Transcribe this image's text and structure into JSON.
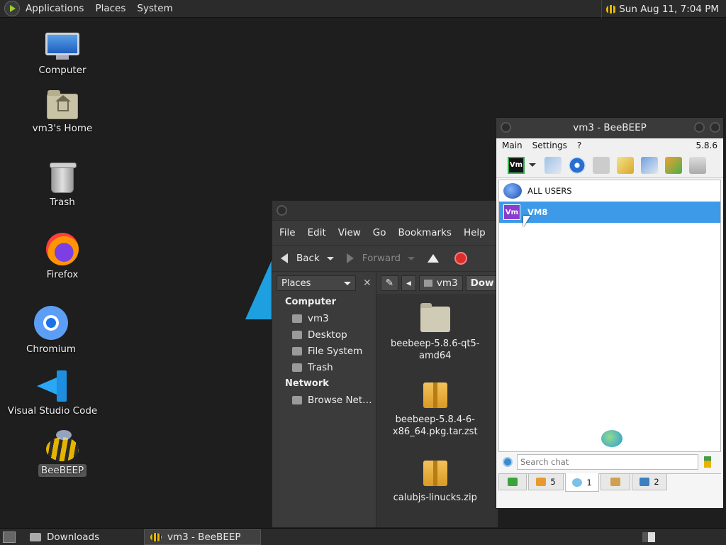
{
  "top_panel": {
    "menus": [
      "Applications",
      "Places",
      "System"
    ],
    "clock": "Sun Aug 11, 7:04 PM"
  },
  "desktop": {
    "icons": [
      {
        "label": "Computer",
        "icon": "computer-icon"
      },
      {
        "label": "vm3's Home",
        "icon": "home-folder-icon"
      },
      {
        "label": "Trash",
        "icon": "trash-icon"
      },
      {
        "label": "Firefox",
        "icon": "firefox-icon"
      },
      {
        "label": "Chromium",
        "icon": "chromium-icon"
      },
      {
        "label": "Visual Studio Code",
        "icon": "vscode-icon"
      },
      {
        "label": "BeeBEEP",
        "icon": "beebeep-icon",
        "selected": true
      }
    ]
  },
  "file_manager": {
    "menu": [
      "File",
      "Edit",
      "View",
      "Go",
      "Bookmarks",
      "Help"
    ],
    "toolbar": {
      "back": "Back",
      "forward": "Forward"
    },
    "places_select": "Places",
    "sidebar": {
      "computer_heading": "Computer",
      "computer_items": [
        "vm3",
        "Desktop",
        "File System",
        "Trash"
      ],
      "network_heading": "Network",
      "network_items": [
        "Browse Net…"
      ]
    },
    "path": {
      "home": "vm3",
      "current": "Dow"
    },
    "files": [
      {
        "name": "beebeep-5.8.6-qt5-amd64",
        "type": "folder"
      },
      {
        "name": "beebeep-5.8.4-6-x86_64.pkg.tar.zst",
        "type": "package"
      },
      {
        "name": "calubjs-linucks.zip",
        "type": "package"
      }
    ]
  },
  "beebeep": {
    "title": "vm3 - BeeBEEP",
    "menu": [
      "Main",
      "Settings",
      "?"
    ],
    "version": "5.8.6",
    "status_badge": "Vm",
    "users": [
      {
        "name": "ALL USERS",
        "icon": "all-users-icon",
        "selected": false
      },
      {
        "name": "VM8",
        "icon": "vm-user-icon",
        "badge": "Vm",
        "selected": true
      }
    ],
    "search_placeholder": "Search chat",
    "tabs": [
      {
        "icon": "computer-tab-icon",
        "count": ""
      },
      {
        "icon": "users-tab-icon",
        "count": "5"
      },
      {
        "icon": "chat-tab-icon",
        "count": "1"
      },
      {
        "icon": "groups-tab-icon",
        "count": ""
      },
      {
        "icon": "files-tab-icon",
        "count": "2"
      }
    ]
  },
  "taskbar": {
    "tasks": [
      "Downloads",
      "vm3 - BeeBEEP"
    ]
  }
}
